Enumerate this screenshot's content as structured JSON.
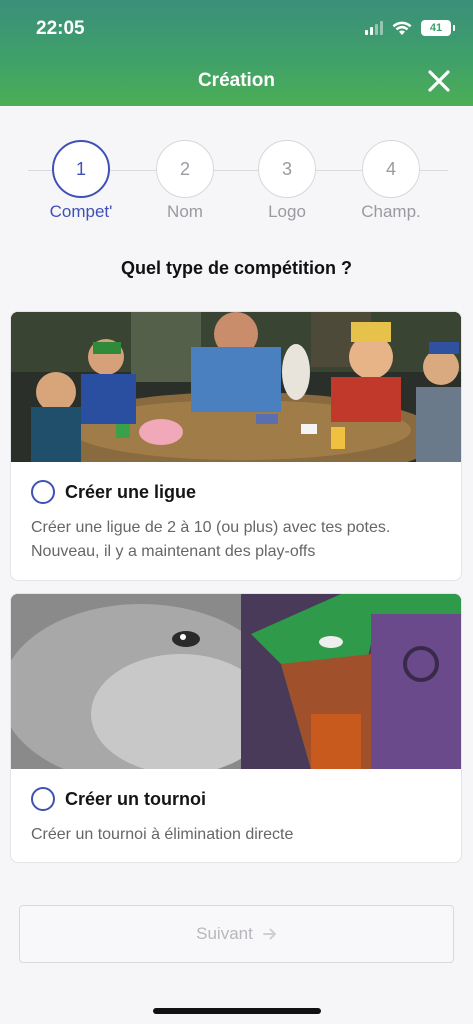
{
  "status_bar": {
    "time": "22:05",
    "battery": "41"
  },
  "header": {
    "title": "Création"
  },
  "stepper": {
    "steps": [
      {
        "number": "1",
        "label": "Compet'"
      },
      {
        "number": "2",
        "label": "Nom"
      },
      {
        "number": "3",
        "label": "Logo"
      },
      {
        "number": "4",
        "label": "Champ."
      }
    ],
    "active_step": 1
  },
  "question": "Quel type de compétition ?",
  "options": [
    {
      "title": "Créer une ligue",
      "description_line1": "Créer une ligue de 2 à 10 (ou plus) avec tes potes.",
      "description_line2": "Nouveau, il y a maintenant des play-offs",
      "image": "poker-table-illustration"
    },
    {
      "title": "Créer un tournoi",
      "description": "Créer un tournoi à élimination directe",
      "image": "warrior-helmet-illustration"
    }
  ],
  "footer": {
    "next_label": "Suivant"
  },
  "colors": {
    "accent": "#3f51b5",
    "header_top": "#3a8f7a",
    "header_bottom": "#4cae55"
  }
}
